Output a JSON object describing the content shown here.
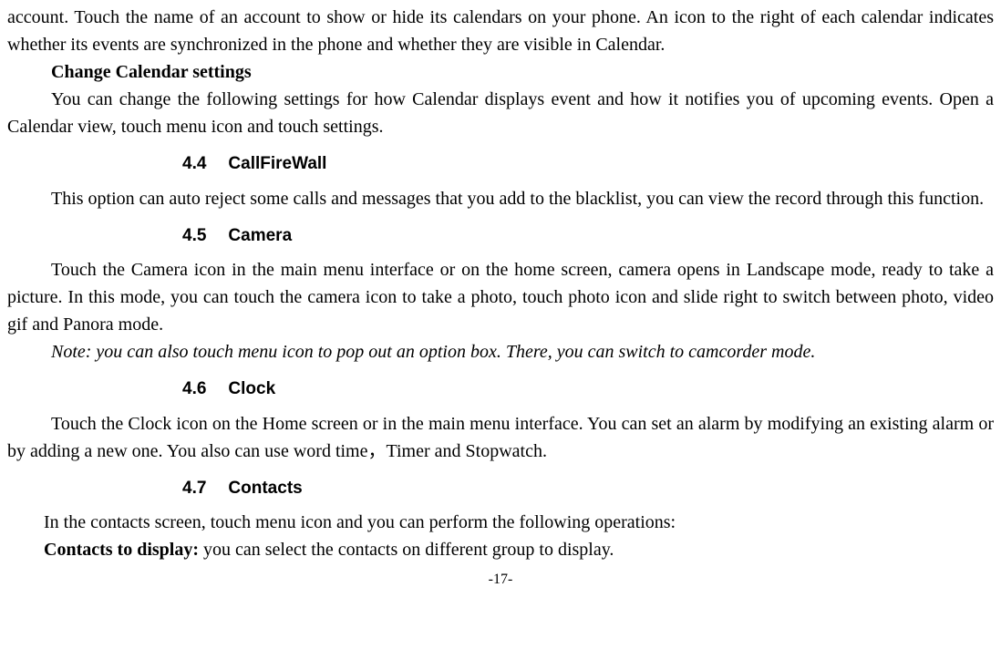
{
  "intro": {
    "p1": "account. Touch the name of an account to show or hide its calendars on your phone. An icon to the right of each calendar indicates whether its events are synchronized in the phone and whether they are visible in Calendar.",
    "h1": "Change Calendar settings",
    "p2": "You can change the following settings for how Calendar displays event and how it notifies you of upcoming events. Open a Calendar view, touch menu icon and touch settings."
  },
  "s44": {
    "num": "4.4",
    "title": "CallFireWall",
    "p1": "This option can auto reject some calls and messages that you add to the blacklist, you can view the record through this function."
  },
  "s45": {
    "num": "4.5",
    "title": "Camera",
    "p1": "Touch the Camera icon in the main menu interface or on the home screen, camera opens in Landscape mode, ready to take a picture. In this mode, you can touch the camera icon to take a photo, touch photo icon and slide right to switch between photo, video gif and Panora mode.",
    "note": "Note: you can also touch menu icon to pop out an option box. There, you can switch to camcorder mode."
  },
  "s46": {
    "num": "4.6",
    "title": "Clock",
    "p1": "Touch the Clock icon on the Home screen or in the main menu interface. You can set an alarm by modifying an existing alarm or by adding a new one. You also can use word time，Timer and Stopwatch."
  },
  "s47": {
    "num": "4.7",
    "title": "Contacts",
    "p1": "In the contacts screen, touch menu icon and you can perform the following operations:",
    "p2_label": "Contacts to display:",
    "p2_rest": " you can select the contacts on different group to display."
  },
  "pagenum": "-17-"
}
